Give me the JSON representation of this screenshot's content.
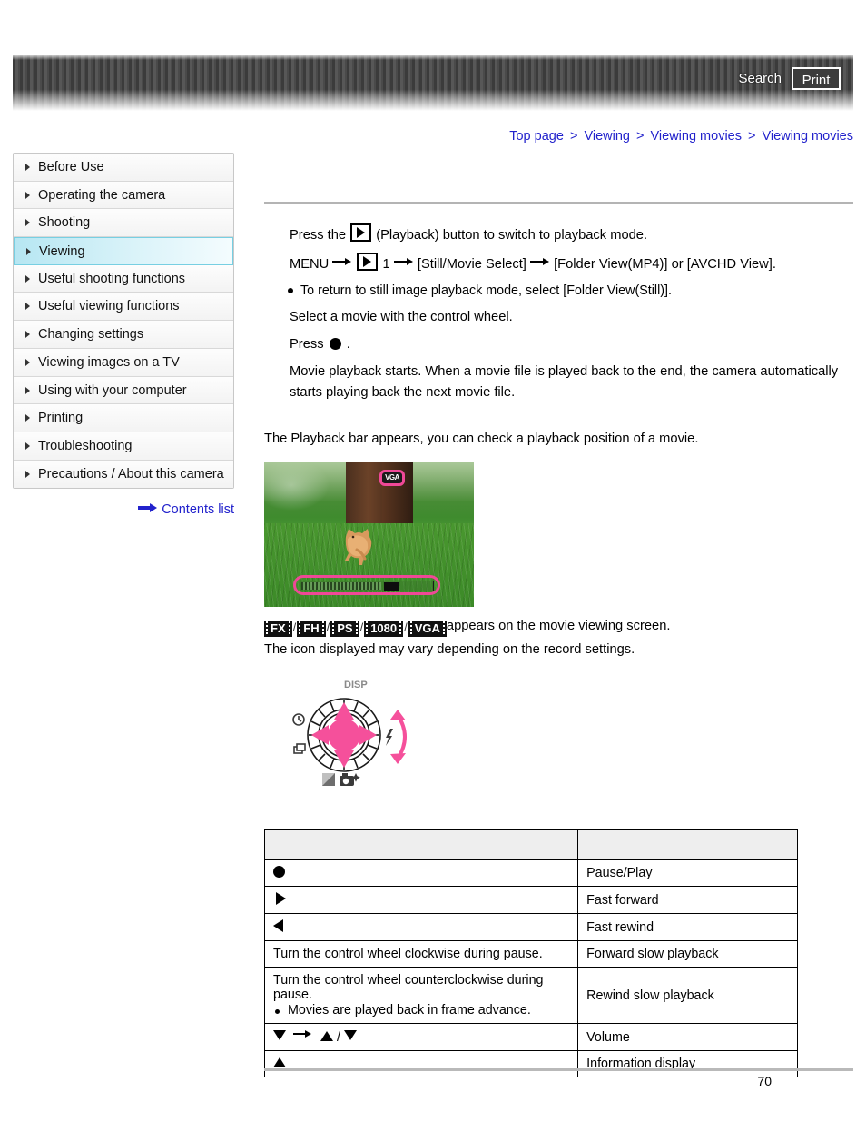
{
  "header": {
    "search_label": "Search",
    "print_label": "Print"
  },
  "breadcrumb": {
    "separator": ">",
    "items": [
      {
        "label": "Top page"
      },
      {
        "label": "Viewing"
      },
      {
        "label": "Viewing movies"
      },
      {
        "label": "Viewing movies"
      }
    ]
  },
  "sidebar": {
    "items": [
      {
        "label": "Before Use",
        "active": false
      },
      {
        "label": "Operating the camera",
        "active": false
      },
      {
        "label": "Shooting",
        "active": false
      },
      {
        "label": "Viewing",
        "active": true
      },
      {
        "label": "Useful shooting functions",
        "active": false
      },
      {
        "label": "Useful viewing functions",
        "active": false
      },
      {
        "label": "Changing settings",
        "active": false
      },
      {
        "label": "Viewing images on a TV",
        "active": false
      },
      {
        "label": "Using with your computer",
        "active": false
      },
      {
        "label": "Printing",
        "active": false
      },
      {
        "label": "Troubleshooting",
        "active": false
      },
      {
        "label": "Precautions / About this camera",
        "active": false
      }
    ],
    "contents_list_label": "Contents list"
  },
  "main": {
    "step1_prefix": "Press the",
    "step1_suffix": "(Playback) button to switch to playback mode.",
    "step2_menu": "MENU",
    "step2_one": "1",
    "step2_select": "[Still/Movie Select]",
    "step2_result": "[Folder View(MP4)] or [AVCHD View].",
    "step2_note": "To return to still image playback mode, select [Folder View(Still)].",
    "step3": "Select a movie with the control wheel.",
    "step4_prefix": "Press",
    "step4_suffix": ".",
    "step4_detail": "Movie playback starts. When a movie file is played back to the end, the camera automatically starts playing back the next movie file.",
    "playback_bar_intro": "The Playback bar appears, you can check a playback position of a movie.",
    "format_note_suffix": "appears on the movie viewing screen.",
    "format_note_line2": "The icon displayed may vary depending on the record settings.",
    "format_badges": [
      "FX",
      "FH",
      "PS",
      "1080",
      "VGA"
    ],
    "format_separator": "/"
  },
  "photo": {
    "vga_badge_label": "VGA"
  },
  "control_wheel": {
    "disp_label": "DISP",
    "icons": {
      "top": "disp-icon",
      "left_upper": "self-timer-icon",
      "left_lower": "drive-mode-icon",
      "right": "flash-icon",
      "bottom_left": "exposure-compensation-icon",
      "bottom_right": "photo-creativity-icon"
    }
  },
  "table": {
    "headers": [
      "",
      ""
    ],
    "rows": [
      {
        "operation_icon": "circle-button",
        "operation_text": "",
        "operation_note": "",
        "function": "Pause/Play"
      },
      {
        "operation_icon": "triangle-right",
        "operation_text": "",
        "operation_note": "",
        "function": "Fast forward"
      },
      {
        "operation_icon": "triangle-left",
        "operation_text": "",
        "operation_note": "",
        "function": "Fast rewind"
      },
      {
        "operation_icon": "",
        "operation_text": "Turn the control wheel clockwise during pause.",
        "operation_note": "",
        "function": "Forward slow playback"
      },
      {
        "operation_icon": "",
        "operation_text": "Turn the control wheel counterclockwise during pause.",
        "operation_note": "Movies are played back in frame advance.",
        "function": "Rewind slow playback"
      },
      {
        "operation_icon": "volume-sequence",
        "operation_text": "",
        "operation_note": "",
        "function": "Volume"
      },
      {
        "operation_icon": "triangle-up",
        "operation_text": "",
        "operation_note": "",
        "function": "Information display"
      }
    ]
  },
  "footer": {
    "page_number": "70"
  },
  "colors": {
    "link": "#2222cc",
    "sidebar_active": "#b6e6f2",
    "highlight_pink": "#ef4897",
    "table_header_bg": "#eeeeee"
  }
}
